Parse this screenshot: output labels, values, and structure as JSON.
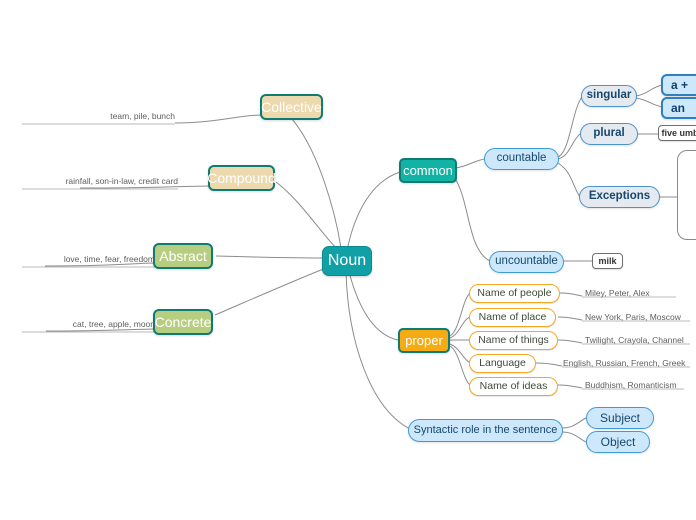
{
  "diagram": {
    "title": "Noun",
    "root": {
      "label": "Noun"
    },
    "left_branches": [
      {
        "label": "Collective",
        "examples": "team, pile, bunch"
      },
      {
        "label": "Compound",
        "examples": "rainfall, son-in-law, credit card"
      },
      {
        "label": "Absract",
        "examples": "love, time, fear, freedom"
      },
      {
        "label": "Concrete",
        "examples": "cat, tree, apple, moon"
      }
    ],
    "common": {
      "label": "common",
      "countable": {
        "label": "countable",
        "children": [
          {
            "label": "singular",
            "examples": [
              "a +",
              "an"
            ]
          },
          {
            "label": "plural",
            "examples": [
              "five umb"
            ]
          },
          {
            "label": "Exceptions",
            "examples": []
          }
        ]
      },
      "uncountable": {
        "label": "uncountable",
        "example": "milk"
      }
    },
    "proper": {
      "label": "proper",
      "children": [
        {
          "label": "Name of people",
          "examples": "Miley, Peter, Alex"
        },
        {
          "label": "Name of place",
          "examples": "New York, Paris, Moscow"
        },
        {
          "label": "Name of things",
          "examples": "Twilight, Crayola, Channel"
        },
        {
          "label": "Language",
          "examples": "English, Russian, French, Greek"
        },
        {
          "label": "Name of ideas",
          "examples": "Buddhism, Romanticism"
        }
      ]
    },
    "syntactic": {
      "label": "Syntactic role in the sentence",
      "children": [
        {
          "label": "Subject"
        },
        {
          "label": "Object"
        }
      ]
    },
    "colors": {
      "root_fill": "#11a0a5",
      "tan_fill": "#ecd9ae",
      "green_fill": "#b7ce80",
      "teal_fill": "#12b2a4",
      "orange_fill": "#f5ab14",
      "blue_pill_fill": "#cde8fa",
      "blue_border": "#3f9ad8",
      "orange_border": "#f5a623",
      "teal_border": "#0e7c73",
      "edge_stroke": "#8c8c8c"
    }
  }
}
